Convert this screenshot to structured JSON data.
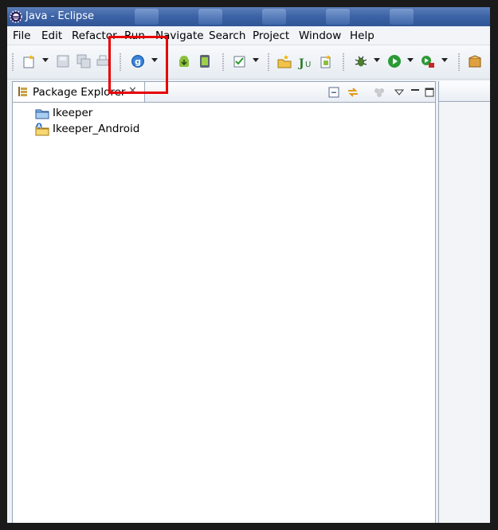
{
  "window": {
    "title": "Java - Eclipse"
  },
  "menu": {
    "items": [
      {
        "label": "File"
      },
      {
        "label": "Edit"
      },
      {
        "label": "Refactor"
      },
      {
        "label": "Run"
      },
      {
        "label": "Navigate"
      },
      {
        "label": "Search"
      },
      {
        "label": "Project"
      },
      {
        "label": "Window"
      },
      {
        "label": "Help"
      }
    ]
  },
  "toolbar": {
    "icons": [
      "new-wizard-icon",
      "save-icon",
      "save-all-icon",
      "print-icon",
      "google-plugin-icon",
      "android-sdk-manager-icon",
      "android-avd-manager-icon",
      "checkbox-task-icon",
      "open-type-icon",
      "new-junit-icon",
      "new-android-project-icon",
      "debug-icon",
      "run-icon",
      "external-tools-icon",
      "package-icon"
    ]
  },
  "explorer": {
    "tab_label": "Package Explorer",
    "projects": [
      {
        "name": "Ikeeper",
        "icon": "java-project-folder-icon"
      },
      {
        "name": "Ikeeper_Android",
        "icon": "android-project-folder-icon"
      }
    ]
  },
  "colors": {
    "highlight": "#e60000",
    "titlebar": "#3c63a6"
  }
}
